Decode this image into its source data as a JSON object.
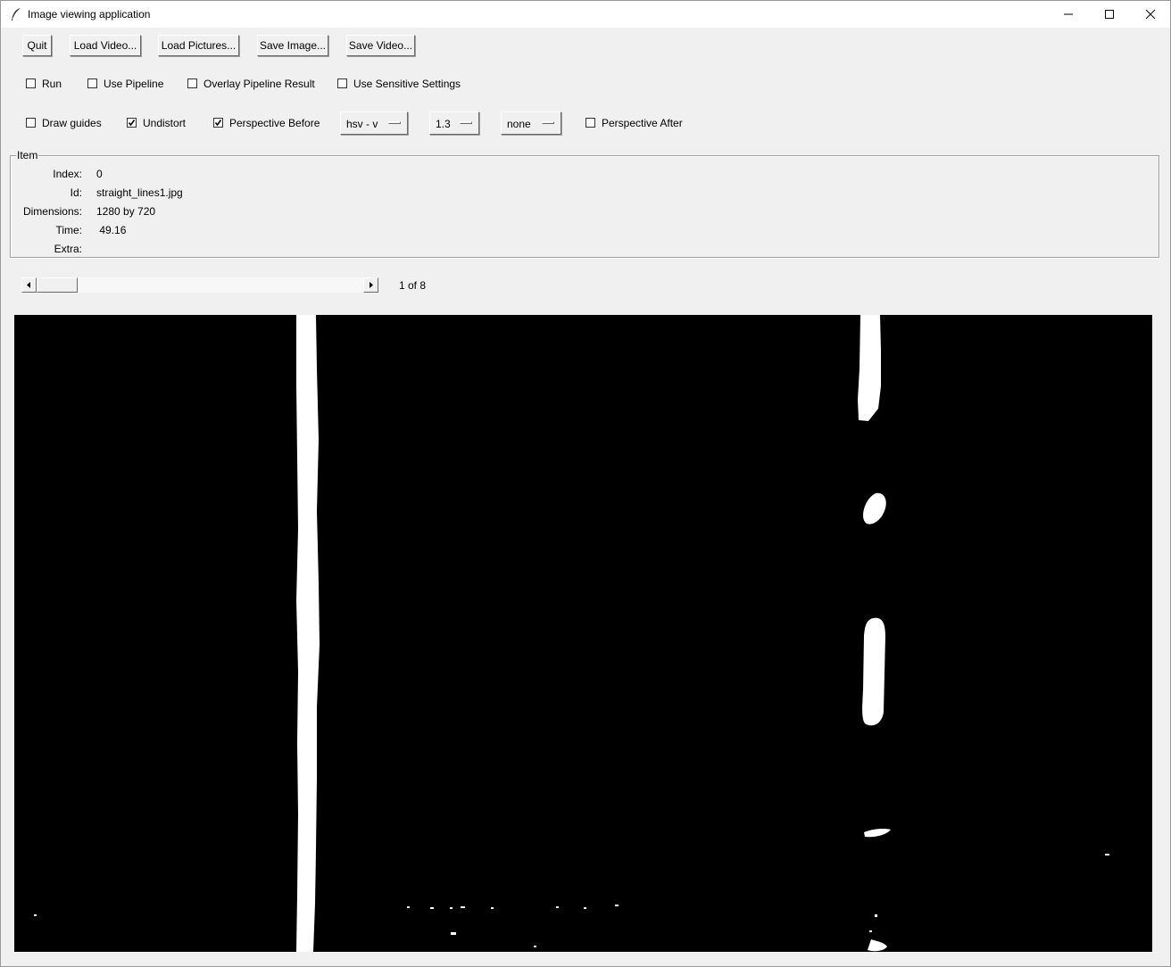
{
  "window": {
    "title": "Image viewing application",
    "controls": [
      "minimize-icon",
      "maximize-icon",
      "close-icon"
    ]
  },
  "toolbar": {
    "quit": "Quit",
    "load_video": "Load Video...",
    "load_pictures": "Load Pictures...",
    "save_image": "Save Image...",
    "save_video": "Save Video..."
  },
  "options_row1": {
    "run": {
      "label": "Run",
      "checked": false
    },
    "use_pipeline": {
      "label": "Use Pipeline",
      "checked": false
    },
    "overlay": {
      "label": "Overlay Pipeline Result",
      "checked": false
    },
    "sensitive": {
      "label": "Use Sensitive Settings",
      "checked": false
    }
  },
  "options_row2": {
    "draw_guides": {
      "label": "Draw guides",
      "checked": false
    },
    "undistort": {
      "label": "Undistort",
      "checked": true
    },
    "perspective_before": {
      "label": "Perspective Before",
      "checked": true
    },
    "color_space": "hsv - v",
    "scale": "1.3",
    "filter": "none",
    "perspective_after": {
      "label": "Perspective After",
      "checked": false
    }
  },
  "item": {
    "legend": "Item",
    "index_label": "Index:",
    "index": "0",
    "id_label": "Id:",
    "id": "straight_lines1.jpg",
    "dimensions_label": "Dimensions:",
    "dimensions": "1280 by 720",
    "time_label": "Time:",
    "time": " 49.16",
    "extra_label": "Extra:",
    "extra": ""
  },
  "navigator": {
    "position_text": "1 of 8",
    "position_fraction": 0.0
  },
  "image": {
    "background": "#000000",
    "foreground": "#ffffff"
  }
}
